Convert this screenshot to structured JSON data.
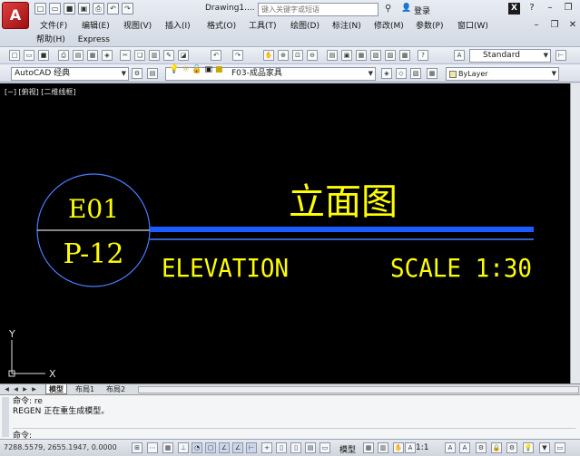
{
  "titlebar": {
    "app_letter": "A",
    "doc_title": "Drawing1....",
    "search_placeholder": "键入关键字或短语",
    "login_label": "登录",
    "x_label": "X"
  },
  "menu": {
    "row1": [
      "文件(F)",
      "编辑(E)",
      "视图(V)",
      "插入(I)",
      "格式(O)",
      "工具(T)",
      "绘图(D)",
      "标注(N)",
      "修改(M)",
      "参数(P)",
      "窗口(W)"
    ],
    "row2": [
      "帮助(H)",
      "Express"
    ]
  },
  "toolbar1": {
    "text_style": "Standard"
  },
  "toolbar2": {
    "workspace": "AutoCAD 经典",
    "layer": "F03-成品家具",
    "color": "ByLayer"
  },
  "viewport": {
    "label": "[−] [俯视] [二维线框]"
  },
  "drawing": {
    "bubble_top": "E01",
    "bubble_bottom": "P-12",
    "title_cn": "立面图",
    "title_en": "ELEVATION",
    "scale": "SCALE 1:30",
    "ucs_x": "X",
    "ucs_y": "Y",
    "colors": {
      "circle": "#4a7dff",
      "text": "#ffff00",
      "thick_line": "#1a5cff",
      "thin_line": "#4a7dff",
      "divider": "#d8d8d8"
    }
  },
  "tabs": {
    "model": "模型",
    "layout1": "布局1",
    "layout2": "布局2"
  },
  "command": {
    "history": [
      "命令:  re",
      "REGEN 正在重生成模型。"
    ],
    "prompt": "命令:"
  },
  "status": {
    "coords": "7288.5579, 2655.1947, 0.0000",
    "model_label": "模型",
    "annotation_scale": "1:1"
  }
}
